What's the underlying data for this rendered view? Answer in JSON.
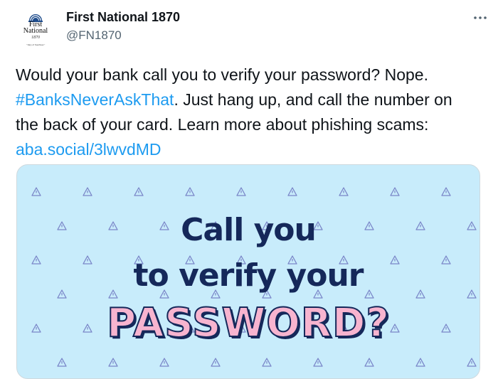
{
  "account": {
    "display_name": "First National 1870",
    "handle": "@FN1870",
    "avatar": {
      "logo_name_line1": "First",
      "logo_name_line2": "National",
      "logo_year": "1870",
      "logo_tagline": "A Subsidiary of Southwest Banks"
    }
  },
  "tweet": {
    "text_1": "Would your bank call you to verify your password? Nope. ",
    "hashtag": "#BanksNeverAskThat",
    "text_2": ". Just hang up, and call the number on the back of your card. Learn more about phishing scams: ",
    "link": "aba.social/3lwvdMD"
  },
  "media": {
    "line1": "Call you",
    "line2": "to verify your",
    "line3": "PASSWORD?",
    "background_color": "#c8ecfb",
    "text_color": "#15285a",
    "accent_pink": "#f7b4cf"
  },
  "icons": {
    "more": "more-options-icon",
    "pattern": "warning-triangle-icon",
    "logo": "bank-dome-icon"
  }
}
